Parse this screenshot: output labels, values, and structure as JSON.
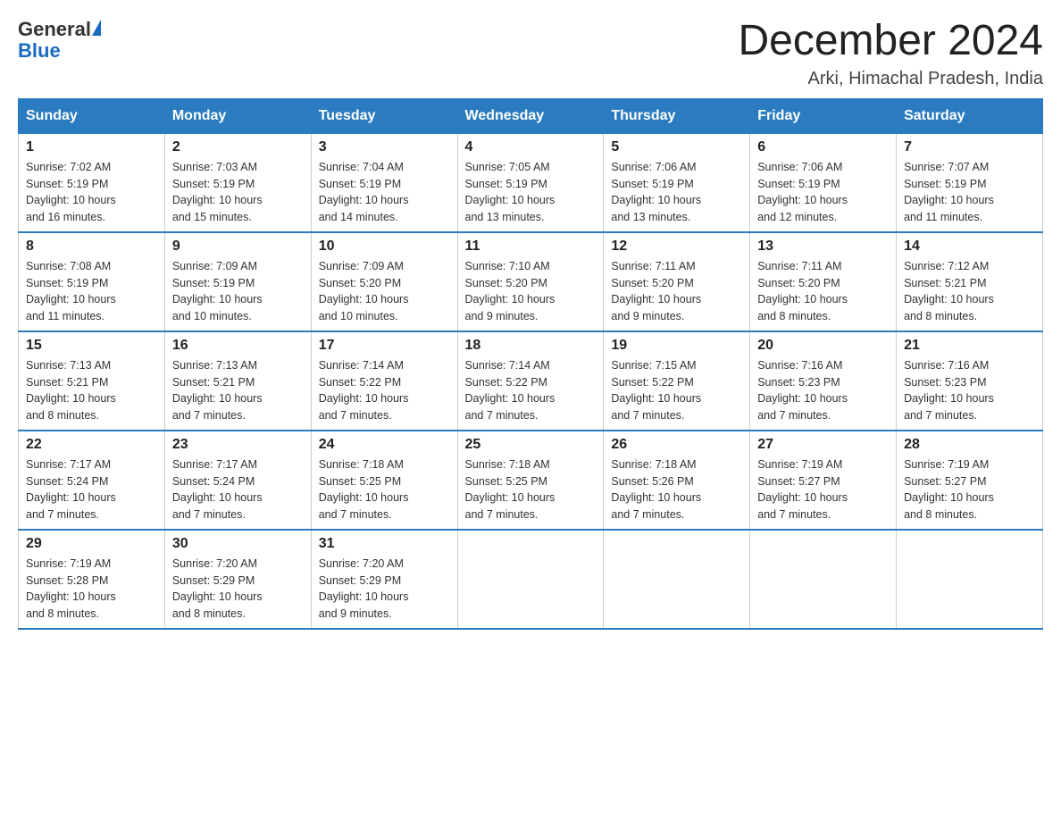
{
  "header": {
    "logo_general": "General",
    "logo_blue": "Blue",
    "month_year": "December 2024",
    "location": "Arki, Himachal Pradesh, India"
  },
  "days_of_week": [
    "Sunday",
    "Monday",
    "Tuesday",
    "Wednesday",
    "Thursday",
    "Friday",
    "Saturday"
  ],
  "weeks": [
    [
      {
        "day": "1",
        "sunrise": "7:02 AM",
        "sunset": "5:19 PM",
        "daylight": "10 hours and 16 minutes."
      },
      {
        "day": "2",
        "sunrise": "7:03 AM",
        "sunset": "5:19 PM",
        "daylight": "10 hours and 15 minutes."
      },
      {
        "day": "3",
        "sunrise": "7:04 AM",
        "sunset": "5:19 PM",
        "daylight": "10 hours and 14 minutes."
      },
      {
        "day": "4",
        "sunrise": "7:05 AM",
        "sunset": "5:19 PM",
        "daylight": "10 hours and 13 minutes."
      },
      {
        "day": "5",
        "sunrise": "7:06 AM",
        "sunset": "5:19 PM",
        "daylight": "10 hours and 13 minutes."
      },
      {
        "day": "6",
        "sunrise": "7:06 AM",
        "sunset": "5:19 PM",
        "daylight": "10 hours and 12 minutes."
      },
      {
        "day": "7",
        "sunrise": "7:07 AM",
        "sunset": "5:19 PM",
        "daylight": "10 hours and 11 minutes."
      }
    ],
    [
      {
        "day": "8",
        "sunrise": "7:08 AM",
        "sunset": "5:19 PM",
        "daylight": "10 hours and 11 minutes."
      },
      {
        "day": "9",
        "sunrise": "7:09 AM",
        "sunset": "5:19 PM",
        "daylight": "10 hours and 10 minutes."
      },
      {
        "day": "10",
        "sunrise": "7:09 AM",
        "sunset": "5:20 PM",
        "daylight": "10 hours and 10 minutes."
      },
      {
        "day": "11",
        "sunrise": "7:10 AM",
        "sunset": "5:20 PM",
        "daylight": "10 hours and 9 minutes."
      },
      {
        "day": "12",
        "sunrise": "7:11 AM",
        "sunset": "5:20 PM",
        "daylight": "10 hours and 9 minutes."
      },
      {
        "day": "13",
        "sunrise": "7:11 AM",
        "sunset": "5:20 PM",
        "daylight": "10 hours and 8 minutes."
      },
      {
        "day": "14",
        "sunrise": "7:12 AM",
        "sunset": "5:21 PM",
        "daylight": "10 hours and 8 minutes."
      }
    ],
    [
      {
        "day": "15",
        "sunrise": "7:13 AM",
        "sunset": "5:21 PM",
        "daylight": "10 hours and 8 minutes."
      },
      {
        "day": "16",
        "sunrise": "7:13 AM",
        "sunset": "5:21 PM",
        "daylight": "10 hours and 7 minutes."
      },
      {
        "day": "17",
        "sunrise": "7:14 AM",
        "sunset": "5:22 PM",
        "daylight": "10 hours and 7 minutes."
      },
      {
        "day": "18",
        "sunrise": "7:14 AM",
        "sunset": "5:22 PM",
        "daylight": "10 hours and 7 minutes."
      },
      {
        "day": "19",
        "sunrise": "7:15 AM",
        "sunset": "5:22 PM",
        "daylight": "10 hours and 7 minutes."
      },
      {
        "day": "20",
        "sunrise": "7:16 AM",
        "sunset": "5:23 PM",
        "daylight": "10 hours and 7 minutes."
      },
      {
        "day": "21",
        "sunrise": "7:16 AM",
        "sunset": "5:23 PM",
        "daylight": "10 hours and 7 minutes."
      }
    ],
    [
      {
        "day": "22",
        "sunrise": "7:17 AM",
        "sunset": "5:24 PM",
        "daylight": "10 hours and 7 minutes."
      },
      {
        "day": "23",
        "sunrise": "7:17 AM",
        "sunset": "5:24 PM",
        "daylight": "10 hours and 7 minutes."
      },
      {
        "day": "24",
        "sunrise": "7:18 AM",
        "sunset": "5:25 PM",
        "daylight": "10 hours and 7 minutes."
      },
      {
        "day": "25",
        "sunrise": "7:18 AM",
        "sunset": "5:25 PM",
        "daylight": "10 hours and 7 minutes."
      },
      {
        "day": "26",
        "sunrise": "7:18 AM",
        "sunset": "5:26 PM",
        "daylight": "10 hours and 7 minutes."
      },
      {
        "day": "27",
        "sunrise": "7:19 AM",
        "sunset": "5:27 PM",
        "daylight": "10 hours and 7 minutes."
      },
      {
        "day": "28",
        "sunrise": "7:19 AM",
        "sunset": "5:27 PM",
        "daylight": "10 hours and 8 minutes."
      }
    ],
    [
      {
        "day": "29",
        "sunrise": "7:19 AM",
        "sunset": "5:28 PM",
        "daylight": "10 hours and 8 minutes."
      },
      {
        "day": "30",
        "sunrise": "7:20 AM",
        "sunset": "5:29 PM",
        "daylight": "10 hours and 8 minutes."
      },
      {
        "day": "31",
        "sunrise": "7:20 AM",
        "sunset": "5:29 PM",
        "daylight": "10 hours and 9 minutes."
      },
      null,
      null,
      null,
      null
    ]
  ],
  "labels": {
    "sunrise": "Sunrise:",
    "sunset": "Sunset:",
    "daylight": "Daylight:"
  }
}
